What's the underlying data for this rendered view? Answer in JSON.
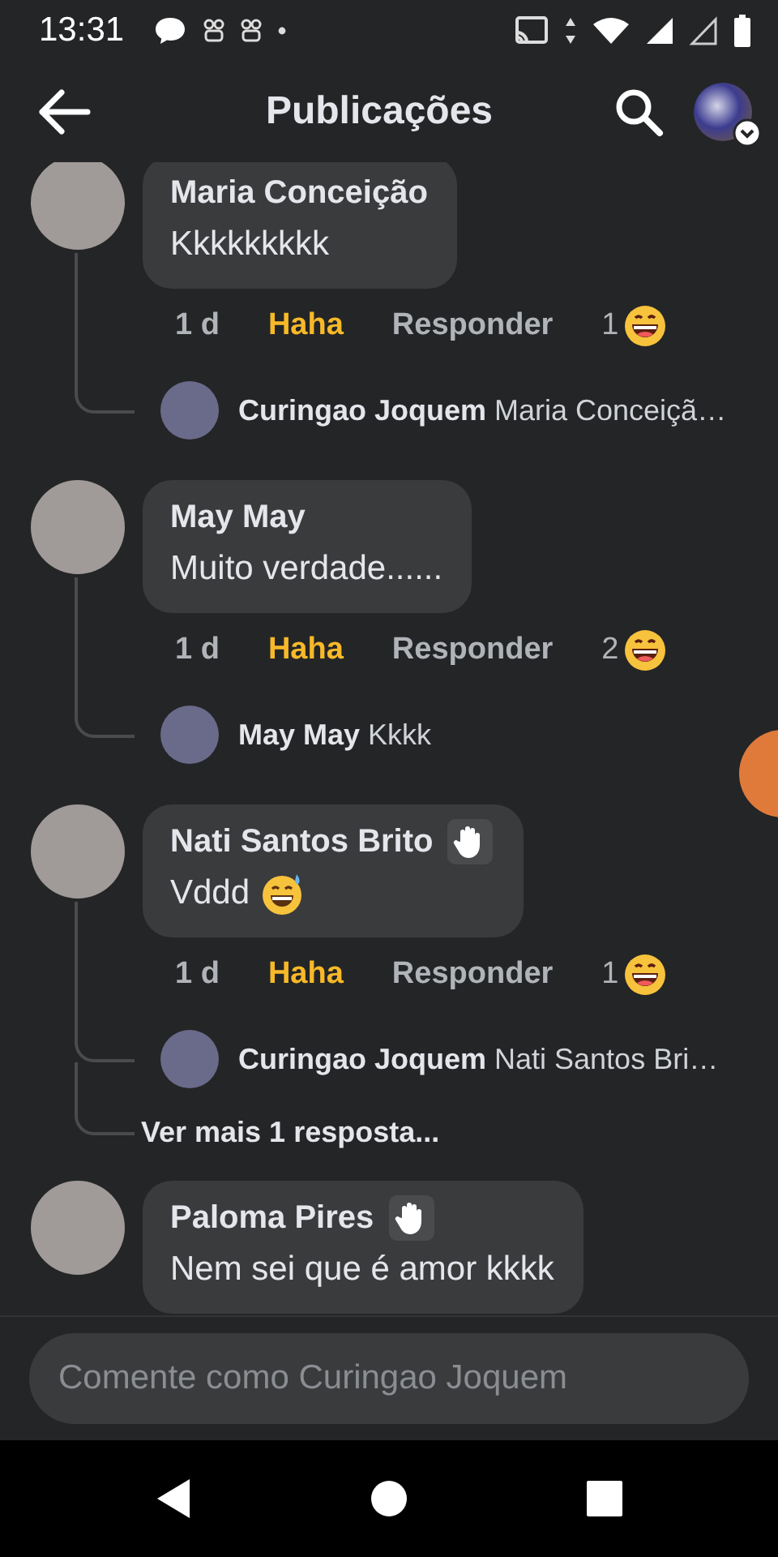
{
  "status_bar": {
    "time": "13:31"
  },
  "header": {
    "title": "Publicações"
  },
  "comments": [
    {
      "author": "Maria Conceição",
      "text": "Kkkkkkkkk",
      "badge": false,
      "emoji": false,
      "time": "1 d",
      "reaction_label": "Haha",
      "reacted": true,
      "reply_label": "Responder",
      "reaction_count": "1",
      "replies": [
        {
          "author": "Curingao Joquem",
          "text": "Maria Conceiçã…"
        }
      ]
    },
    {
      "author": "May May",
      "text": "Muito verdade......",
      "badge": false,
      "emoji": false,
      "time": "1 d",
      "reaction_label": "Haha",
      "reacted": true,
      "reply_label": "Responder",
      "reaction_count": "2",
      "replies": [
        {
          "author": "May May",
          "text": "Kkkk"
        }
      ]
    },
    {
      "author": "Nati Santos Brito",
      "text": "Vddd",
      "badge": true,
      "emoji": true,
      "time": "1 d",
      "reaction_label": "Haha",
      "reacted": true,
      "reply_label": "Responder",
      "reaction_count": "1",
      "replies": [
        {
          "author": "Curingao Joquem",
          "text": "Nati Santos Bri…"
        }
      ],
      "more_replies": "Ver mais 1 resposta..."
    },
    {
      "author": "Paloma Pires",
      "text": "Nem sei que é amor kkkk",
      "badge": true,
      "emoji": false
    }
  ],
  "composer": {
    "placeholder": "Comente como Curingao Joquem"
  }
}
